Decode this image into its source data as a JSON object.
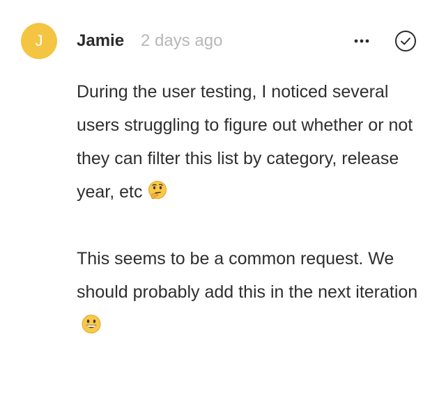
{
  "comment": {
    "avatar_initial": "J",
    "author": "Jamie",
    "timestamp": "2 days ago",
    "paragraphs": [
      {
        "text": "During the user testing, I noticed several users struggling to figure out whether or not they can filter this list by category, release year, etc",
        "emoji": "thinking-face-emoji"
      },
      {
        "text": "This seems to be a common request. We should probably add this in the next iteration",
        "emoji": "grinning-face-emoji"
      }
    ],
    "icons": {
      "more": "more-horizontal-icon",
      "resolve": "check-circle-icon"
    }
  },
  "colors": {
    "avatar": "#f4c542",
    "text": "#2e2e2e",
    "muted": "#b7b7b7"
  }
}
